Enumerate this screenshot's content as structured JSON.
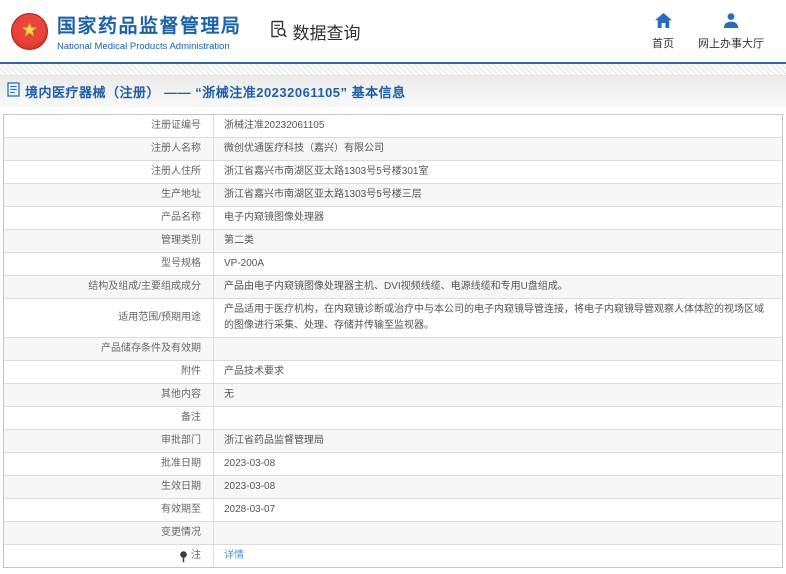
{
  "colors": {
    "accent_blue": "#1b62a7",
    "nav_icon_blue": "#2a6bbf",
    "link_blue": "#4f94d5",
    "emblem_red": "#d7332a",
    "emblem_gold": "#f9d648",
    "row_alt_bg": "#f7f7f7",
    "table_border": "#dcdcdc"
  },
  "header": {
    "org_name_cn": "国家药品监督管理局",
    "org_name_en": "National Medical Products Administration",
    "section_title": "数据查询",
    "nav": [
      {
        "label": "首页",
        "icon": "home-icon"
      },
      {
        "label": "网上办事大厅",
        "icon": "user-icon"
      }
    ]
  },
  "breadcrumb": {
    "text": "境内医疗器械（注册） —— “浙械注准20232061105” 基本信息"
  },
  "table": {
    "rows": [
      {
        "label": "注册证编号",
        "value": "浙械注准20232061105"
      },
      {
        "label": "注册人名称",
        "value": "微创优通医疗科技（嘉兴）有限公司"
      },
      {
        "label": "注册人住所",
        "value": "浙江省嘉兴市南湖区亚太路1303号5号楼301室"
      },
      {
        "label": "生产地址",
        "value": "浙江省嘉兴市南湖区亚太路1303号5号楼三层"
      },
      {
        "label": "产品名称",
        "value": "电子内窥镜图像处理器"
      },
      {
        "label": "管理类别",
        "value": "第二类"
      },
      {
        "label": "型号规格",
        "value": "VP-200A"
      },
      {
        "label": "结构及组成/主要组成成分",
        "value": "产品由电子内窥镜图像处理器主机、DVI视频线缆、电源线缆和专用U盘组成。"
      },
      {
        "label": "适用范围/预期用途",
        "value": "产品适用于医疗机构，在内窥镜诊断或治疗中与本公司的电子内窥镜导管连接，将电子内窥镜导管观察人体体腔的视场区域的图像进行采集、处理、存储并传输至监视器。"
      },
      {
        "label": "产品储存条件及有效期",
        "value": ""
      },
      {
        "label": "附件",
        "value": "产品技术要求"
      },
      {
        "label": "其他内容",
        "value": "无"
      },
      {
        "label": "备注",
        "value": ""
      },
      {
        "label": "审批部门",
        "value": "浙江省药品监督管理局"
      },
      {
        "label": "批准日期",
        "value": "2023-03-08"
      },
      {
        "label": "生效日期",
        "value": "2023-03-08"
      },
      {
        "label": "有效期至",
        "value": "2028-03-07"
      },
      {
        "label": "变更情况",
        "value": ""
      },
      {
        "label": "注",
        "value": "详情"
      }
    ]
  }
}
